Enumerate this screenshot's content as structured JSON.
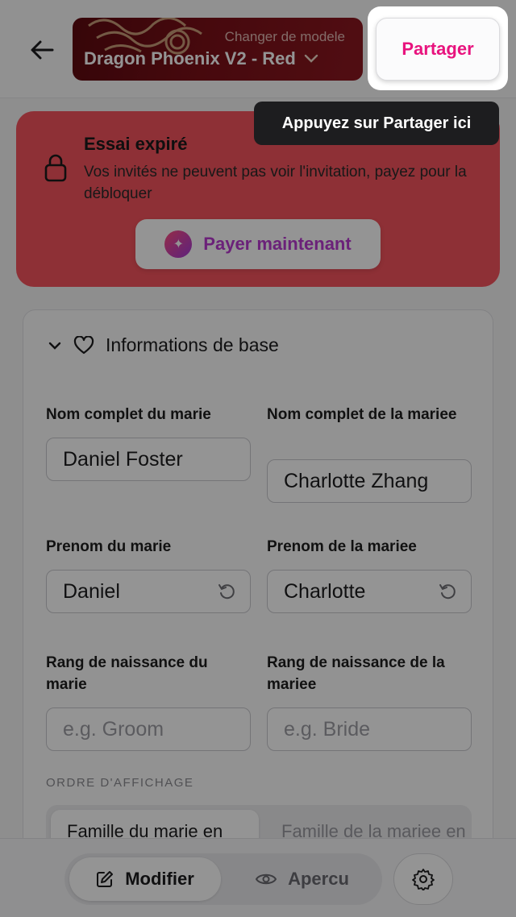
{
  "header": {
    "template_hint": "Changer de modele",
    "template_name": "Dragon Phoenix V2 - Red",
    "share_label": "Partager"
  },
  "tooltip": {
    "text": "Appuyez sur Partager ici"
  },
  "banner": {
    "title": "Essai expiré",
    "description": "Vos invités ne peuvent pas voir l'invitation, payez pour la débloquer",
    "pay_label": "Payer maintenant",
    "color": "#f4535d"
  },
  "form": {
    "section_title": "Informations de base",
    "groom_full_name": {
      "label": "Nom complet du marie",
      "value": "Daniel Foster"
    },
    "bride_full_name": {
      "label": "Nom complet de la mariee",
      "value": "Charlotte Zhang"
    },
    "groom_first_name": {
      "label": "Prenom du marie",
      "value": "Daniel"
    },
    "bride_first_name": {
      "label": "Prenom de la mariee",
      "value": "Charlotte"
    },
    "groom_rank": {
      "label": "Rang de naissance du marie",
      "placeholder": "e.g. Groom"
    },
    "bride_rank": {
      "label": "Rang de naissance de la mariee",
      "placeholder": "e.g. Bride"
    },
    "order_label": "ORDRE D'AFFICHAGE",
    "order_options": [
      "Famille du marie en",
      "Famille de la mariee en"
    ]
  },
  "bottom_bar": {
    "edit_label": "Modifier",
    "preview_label": "Apercu"
  },
  "colors": {
    "accent": "#e8137e",
    "pay": "#b83ad0"
  }
}
